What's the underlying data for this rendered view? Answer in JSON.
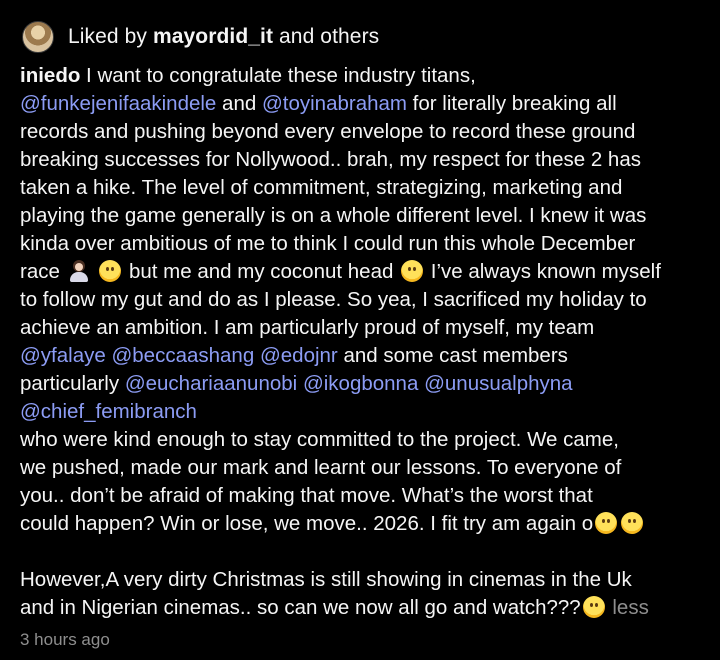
{
  "likes": {
    "prefix": "Liked by ",
    "user": "mayordid_it",
    "suffix": " and others"
  },
  "caption": {
    "username": "iniedo",
    "lines": [
      [
        {
          "t": "text",
          "v": " I want to congratulate these industry titans,"
        }
      ],
      [
        {
          "t": "mention",
          "v": "@funkejenifaakindele"
        },
        {
          "t": "text",
          "v": " and "
        },
        {
          "t": "mention",
          "v": "@toyinabraham"
        },
        {
          "t": "text",
          "v": " for literally breaking all"
        }
      ],
      [
        {
          "t": "text",
          "v": "records and pushing beyond every envelope to record these ground"
        }
      ],
      [
        {
          "t": "text",
          "v": "breaking successes for Nollywood.. brah, my respect for these 2 has"
        }
      ],
      [
        {
          "t": "text",
          "v": "taken a hike. The level of commitment, strategizing, marketing and"
        }
      ],
      [
        {
          "t": "text",
          "v": "playing the game generally is on a whole different level. I knew it was"
        }
      ],
      [
        {
          "t": "text",
          "v": "kinda over ambitious of me to think I could run this whole December"
        }
      ],
      [
        {
          "t": "text",
          "v": "race "
        },
        {
          "t": "emoji",
          "v": "person-facepalming-emoji"
        },
        {
          "t": "text",
          "v": " "
        },
        {
          "t": "emoji",
          "v": "grinning-face-emoji"
        },
        {
          "t": "text",
          "v": " but me and my coconut head "
        },
        {
          "t": "emoji",
          "v": "face-with-rolling-eyes-emoji"
        },
        {
          "t": "text",
          "v": " I’ve always known myself"
        }
      ],
      [
        {
          "t": "text",
          "v": "to follow my gut and do as I please. So yea, I sacrificed my holiday to"
        }
      ],
      [
        {
          "t": "text",
          "v": "achieve an ambition. I am particularly proud of myself, my team"
        }
      ],
      [
        {
          "t": "mention",
          "v": "@yfalaye"
        },
        {
          "t": "text",
          "v": " "
        },
        {
          "t": "mention",
          "v": "@beccaashang"
        },
        {
          "t": "text",
          "v": " "
        },
        {
          "t": "mention",
          "v": "@edojnr"
        },
        {
          "t": "text",
          "v": " and some cast members"
        }
      ],
      [
        {
          "t": "text",
          "v": "particularly "
        },
        {
          "t": "mention",
          "v": "@euchariaanunobi"
        },
        {
          "t": "text",
          "v": " "
        },
        {
          "t": "mention",
          "v": "@ikogbonna"
        },
        {
          "t": "text",
          "v": " "
        },
        {
          "t": "mention",
          "v": "@unusualphyna"
        }
      ],
      [
        {
          "t": "mention",
          "v": "@chief_femibranch"
        }
      ],
      [
        {
          "t": "text",
          "v": "who were kind enough to stay committed to the project. We came,"
        }
      ],
      [
        {
          "t": "text",
          "v": "we pushed, made our mark and learnt our lessons. To everyone of"
        }
      ],
      [
        {
          "t": "text",
          "v": "you.. don’t be afraid of making that move. What’s the worst that"
        }
      ],
      [
        {
          "t": "text",
          "v": "could happen? Win or lose, we move.. 2026. I fit try am again o"
        },
        {
          "t": "emoji",
          "v": "thinking-face-emoji"
        },
        {
          "t": "emoji",
          "v": "rolling-on-the-floor-laughing-emoji"
        }
      ],
      [],
      [
        {
          "t": "text",
          "v": "However,A very dirty Christmas is still showing in cinemas in the Uk"
        }
      ],
      [
        {
          "t": "text",
          "v": "and in Nigerian cinemas.. so can we now all go and watch???"
        },
        {
          "t": "emoji",
          "v": "smiling-face-emoji"
        },
        {
          "t": "text",
          "v": " "
        },
        {
          "t": "less",
          "v": "less"
        }
      ]
    ]
  },
  "timestamp": "3 hours ago",
  "colors": {
    "background": "#000000",
    "text": "#f5f5f5",
    "mention": "#8c9cf4",
    "muted": "#8e8e8e"
  }
}
